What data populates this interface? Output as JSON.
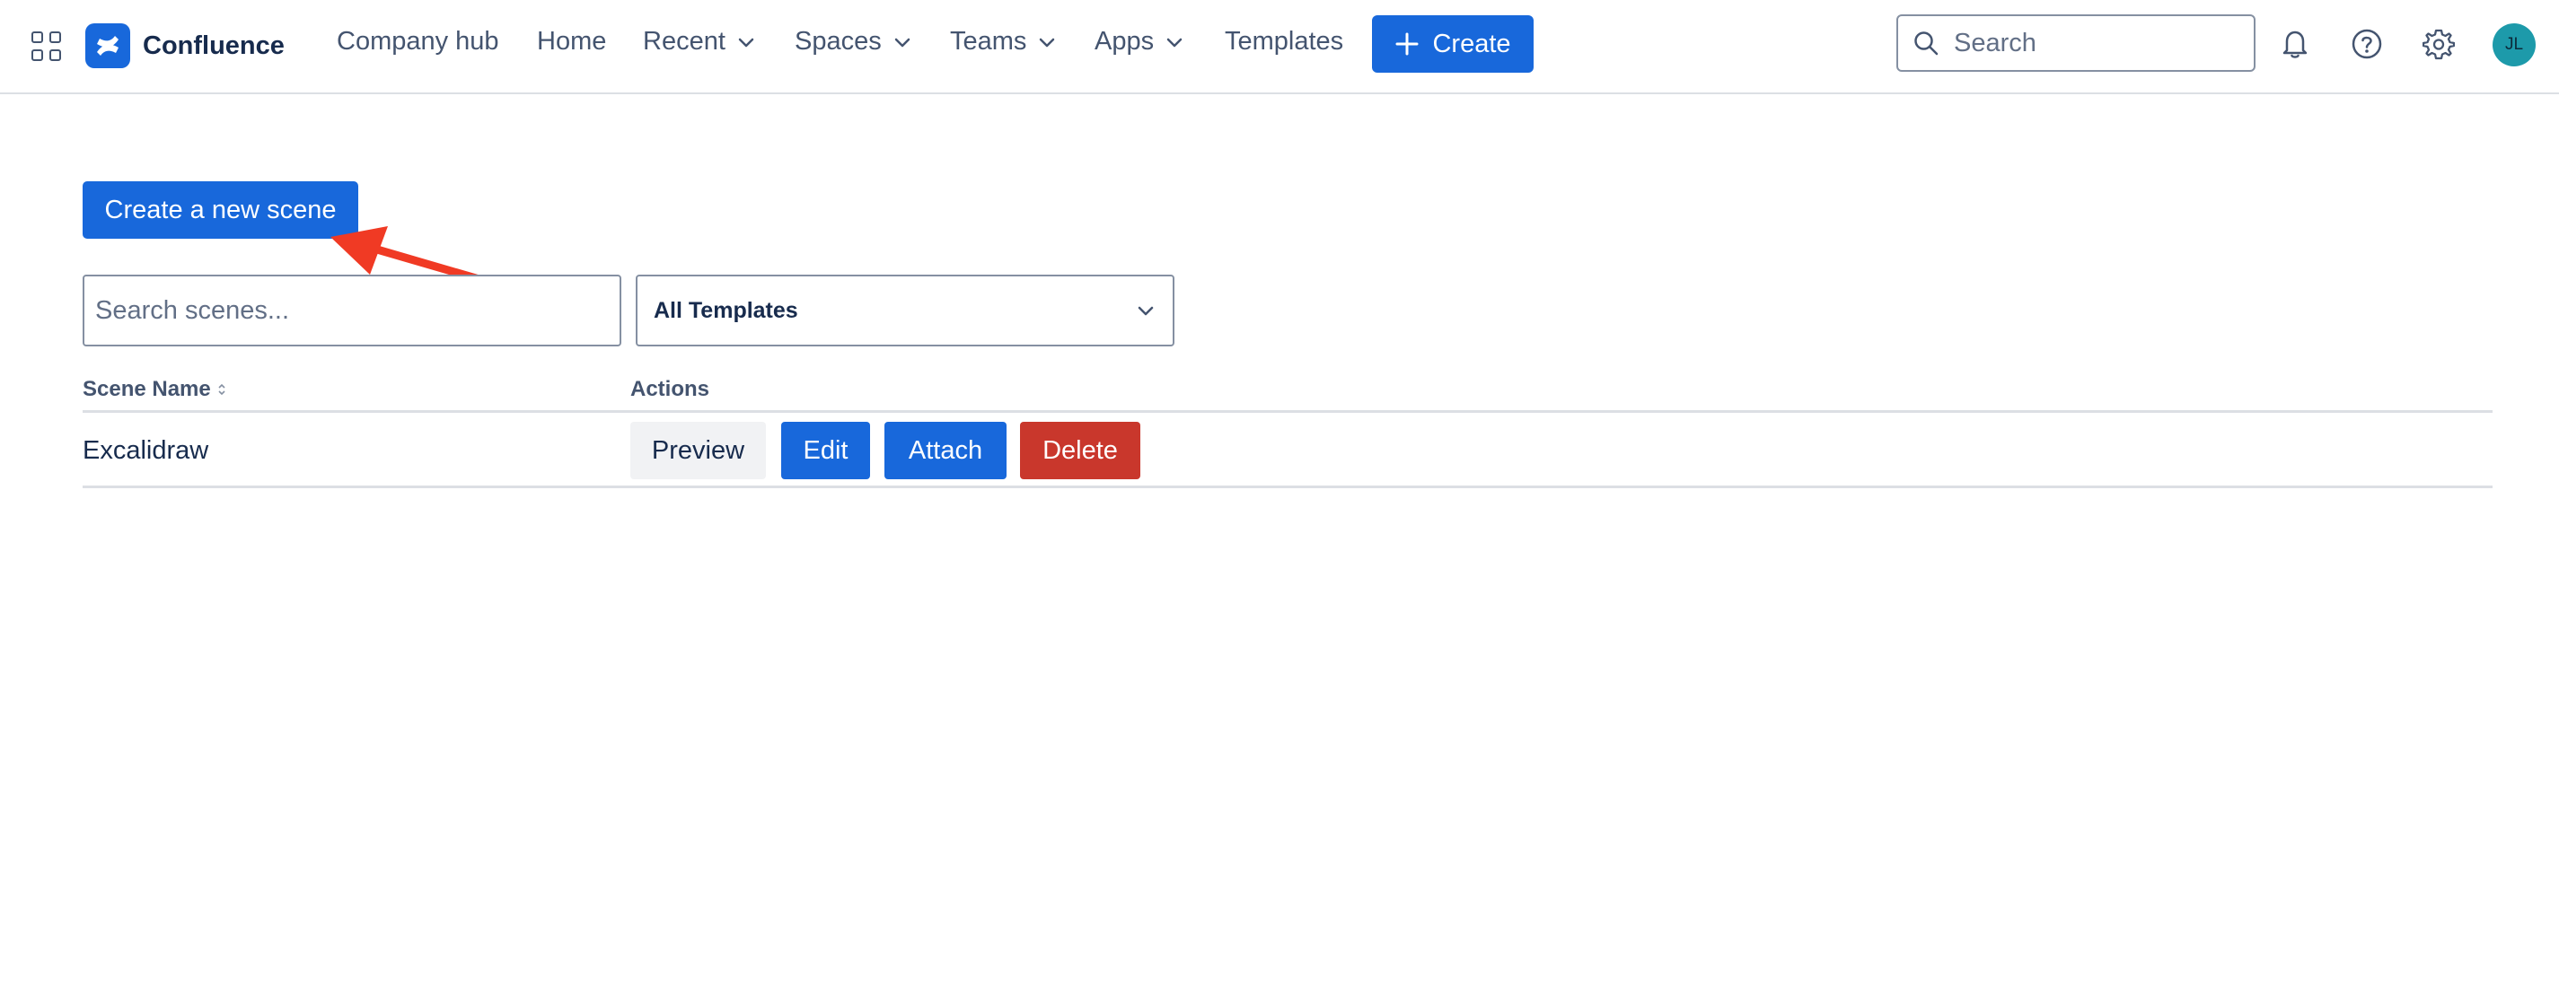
{
  "topnav": {
    "app_name": "Confluence",
    "items": [
      {
        "label": "Company hub",
        "has_menu": false
      },
      {
        "label": "Home",
        "has_menu": false
      },
      {
        "label": "Recent",
        "has_menu": true
      },
      {
        "label": "Spaces",
        "has_menu": true
      },
      {
        "label": "Teams",
        "has_menu": true
      },
      {
        "label": "Apps",
        "has_menu": true
      },
      {
        "label": "Templates",
        "has_menu": false
      }
    ],
    "create_label": "Create",
    "search_placeholder": "Search",
    "avatar_initials": "JL",
    "icons": [
      "app-switcher-icon",
      "confluence-logo-icon",
      "search-icon",
      "bell-icon",
      "help-icon",
      "gear-icon"
    ]
  },
  "main": {
    "new_scene_label": "Create a new scene",
    "search_placeholder": "Search scenes...",
    "template_filter": "All Templates",
    "table": {
      "columns": [
        "Scene Name",
        "Actions"
      ],
      "rows": [
        {
          "name": "Excalidraw",
          "actions": [
            "Preview",
            "Edit",
            "Attach",
            "Delete"
          ]
        }
      ]
    }
  },
  "colors": {
    "primary": "#1868db",
    "danger": "#c9372c",
    "annotation_arrow": "#f03a24",
    "avatar": "#1d9aaa"
  }
}
